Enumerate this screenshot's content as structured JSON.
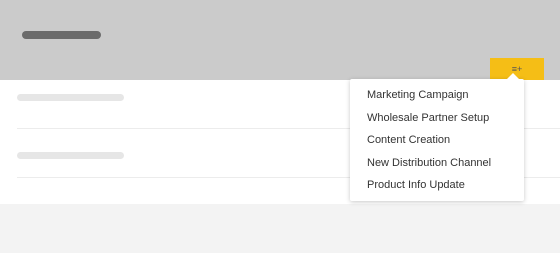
{
  "header": {
    "add_button_icon": "list-add-icon",
    "add_button_glyph": "≡+"
  },
  "dropdown": {
    "items": [
      "Marketing Campaign",
      "Wholesale Partner Setup",
      "Content Creation",
      "New Distribution Channel",
      "Product Info Update"
    ]
  },
  "colors": {
    "header_bg": "#cbcbcb",
    "accent": "#f5be16",
    "page_bg": "#f3f3f3",
    "content_bg": "#ffffff"
  }
}
